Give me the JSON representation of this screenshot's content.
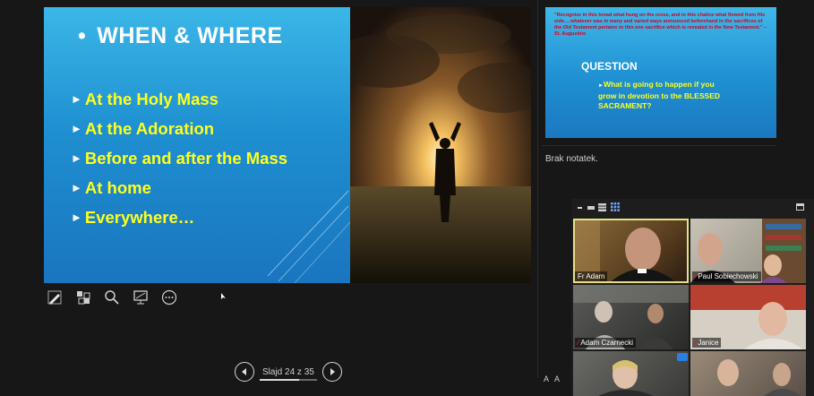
{
  "slide": {
    "title_bullet": "•",
    "title": "WHEN & WHERE",
    "bullets": [
      "At the Holy Mass",
      "At the Adoration",
      "Before and after the Mass",
      "At home",
      "Everywhere…"
    ],
    "bullet_marker": "►"
  },
  "toolbar": {
    "tools": [
      "pen-icon",
      "slide-grid-icon",
      "zoom-icon",
      "screen-icon",
      "more-options-icon"
    ]
  },
  "navigation": {
    "counter": "Slajd 24 z 35",
    "progress": 0.6857
  },
  "next_slide": {
    "quote": "\"Recognize in this bread what hung on the cross, and in this chalice what flowed from His side… whatever was in many and varied ways announced beforehand in the sacrifices of the Old Testament pertains to this one sacrifice which is revealed in the New Testament.\" – St. Augustine",
    "question_title": "QUESTION",
    "question_marker": "►",
    "question_text": "What is going to happen if you grow in devotion to the BLESSED SACRAMENT?"
  },
  "notes": {
    "text": "Brak notatek."
  },
  "video": {
    "participants": [
      {
        "name": "Fr Adam",
        "muted": false,
        "active": true
      },
      {
        "name": "Paul Sobiechowski",
        "muted": true,
        "active": false
      },
      {
        "name": "Adam Czarnecki",
        "muted": true,
        "active": false
      },
      {
        "name": "Janice",
        "muted": true,
        "active": false
      },
      {
        "name": "",
        "muted": false,
        "active": false
      },
      {
        "name": "",
        "muted": false,
        "active": false
      }
    ],
    "mic_glyph": "⁄"
  },
  "font_buttons": [
    "A",
    "A"
  ],
  "colors": {
    "slide_title": "#ffffff",
    "bullet_text": "#ffff1e",
    "quote_text": "#d8001d",
    "active_speaker": "#e6e08a"
  }
}
